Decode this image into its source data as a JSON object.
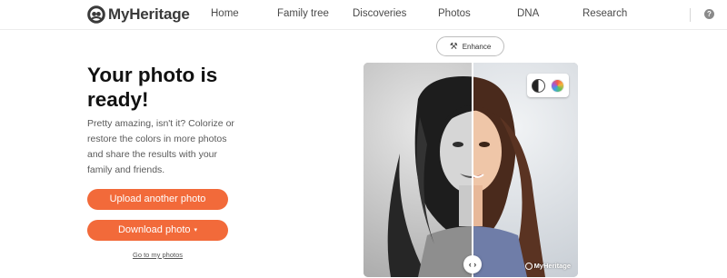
{
  "brand": {
    "name": "MyHeritage",
    "accent": "#f26a3a"
  },
  "nav": {
    "items": [
      {
        "label": "Home"
      },
      {
        "label": "Family tree"
      },
      {
        "label": "Discoveries"
      },
      {
        "label": "Photos"
      },
      {
        "label": "DNA"
      },
      {
        "label": "Research"
      }
    ],
    "help_icon": "help-icon"
  },
  "main": {
    "title": "Your photo is ready!",
    "description": "Pretty amazing, isn't it? Colorize or restore the colors in more photos and share the results with your family and friends.",
    "upload_label": "Upload another photo",
    "download_label": "Download photo",
    "download_caret": "▾",
    "go_to_photos": "Go to my photos"
  },
  "photo_viewer": {
    "enhance_label": "Enhance",
    "enhance_icon": "magic-wand-icon",
    "palette_icons": [
      "black-white-mode-icon",
      "color-mode-icon"
    ],
    "watermark": "MyHeritage",
    "handle_label": "‹ ›"
  }
}
